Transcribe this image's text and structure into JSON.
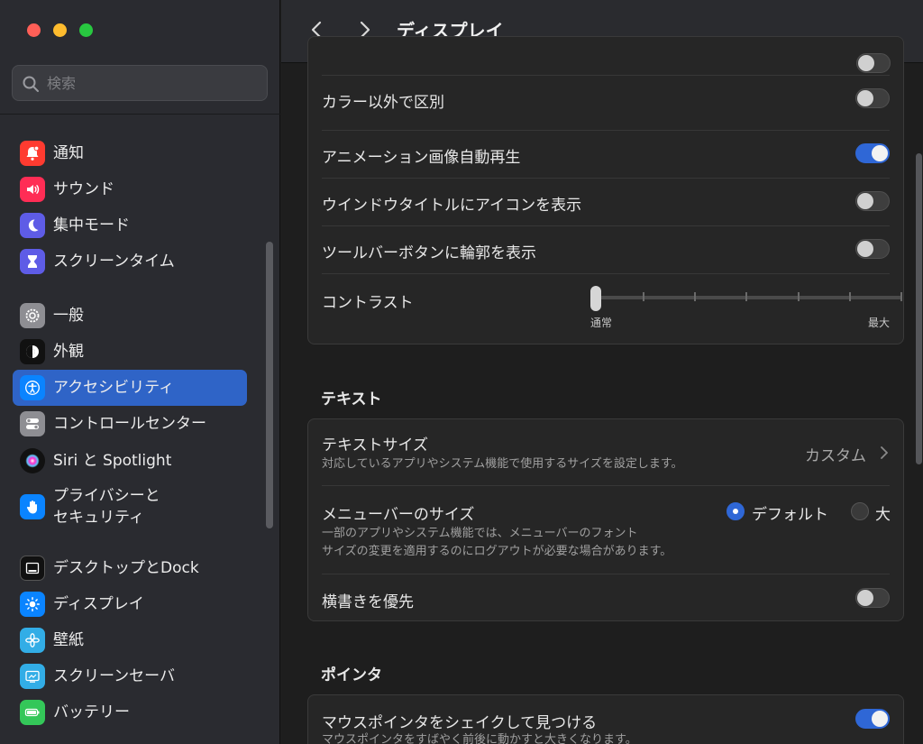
{
  "window": {
    "title": "ディスプレイ"
  },
  "search": {
    "placeholder": "検索"
  },
  "sidebar": {
    "items": [
      {
        "label": "通知",
        "icon": "bell-icon",
        "color": "#ff3b30"
      },
      {
        "label": "サウンド",
        "icon": "speaker-icon",
        "color": "#ff2d55"
      },
      {
        "label": "集中モード",
        "icon": "moon-icon",
        "color": "#5e5ce6"
      },
      {
        "label": "スクリーンタイム",
        "icon": "hourglass-icon",
        "color": "#5e5ce6"
      },
      {
        "label": "一般",
        "icon": "gear-icon",
        "color": "#8e8e93"
      },
      {
        "label": "外観",
        "icon": "appearance-icon",
        "color": "#1c1c1e"
      },
      {
        "label": "アクセシビリティ",
        "icon": "accessibility-icon",
        "color": "#0a84ff",
        "active": true
      },
      {
        "label": "コントロールセンター",
        "icon": "control-center-icon",
        "color": "#8e8e93"
      },
      {
        "label": "Siri と Spotlight",
        "icon": "siri-icon",
        "color": "#1c1c1e"
      },
      {
        "label": "プライバシーと\nセキュリティ",
        "icon": "hand-icon",
        "color": "#0a84ff"
      },
      {
        "label": "デスクトップとDock",
        "icon": "dock-icon",
        "color": "#1c1c1e"
      },
      {
        "label": "ディスプレイ",
        "icon": "sun-icon",
        "color": "#0a84ff"
      },
      {
        "label": "壁紙",
        "icon": "flower-icon",
        "color": "#32ade6"
      },
      {
        "label": "スクリーンセーバ",
        "icon": "screensaver-icon",
        "color": "#32ade6"
      },
      {
        "label": "バッテリー",
        "icon": "battery-icon",
        "color": "#34c759"
      }
    ]
  },
  "display_group": {
    "rows": [
      {
        "label": "カラー以外で区別",
        "toggle": false
      },
      {
        "label": "アニメーション画像自動再生",
        "toggle": true
      },
      {
        "label": "ウインドウタイトルにアイコンを表示",
        "toggle": false
      },
      {
        "label": "ツールバーボタンに輪郭を表示",
        "toggle": false
      }
    ],
    "contrast": {
      "label": "コントラスト",
      "min_label": "通常",
      "max_label": "最大",
      "value": 0
    }
  },
  "text_section": {
    "title": "テキスト",
    "text_size": {
      "label": "テキストサイズ",
      "sub": "対応しているアプリやシステム機能で使用するサイズを設定します。",
      "value": "カスタム"
    },
    "menubar_size": {
      "label": "メニューバーのサイズ",
      "sub": "一部のアプリやシステム機能では、メニューバーのフォント\nサイズの変更を適用するのにログアウトが必要な場合があります。",
      "options": [
        {
          "label": "デフォルト",
          "selected": true
        },
        {
          "label": "大",
          "selected": false
        }
      ]
    },
    "prefer_horizontal": {
      "label": "横書きを優先",
      "toggle": false
    }
  },
  "pointer_section": {
    "title": "ポインタ",
    "shake": {
      "label": "マウスポインタをシェイクして見つける",
      "sub": "マウスポインタをすばやく前後に動かすと大きくなります。",
      "toggle": true
    }
  },
  "colors": {
    "accent": "#2f67d6"
  }
}
